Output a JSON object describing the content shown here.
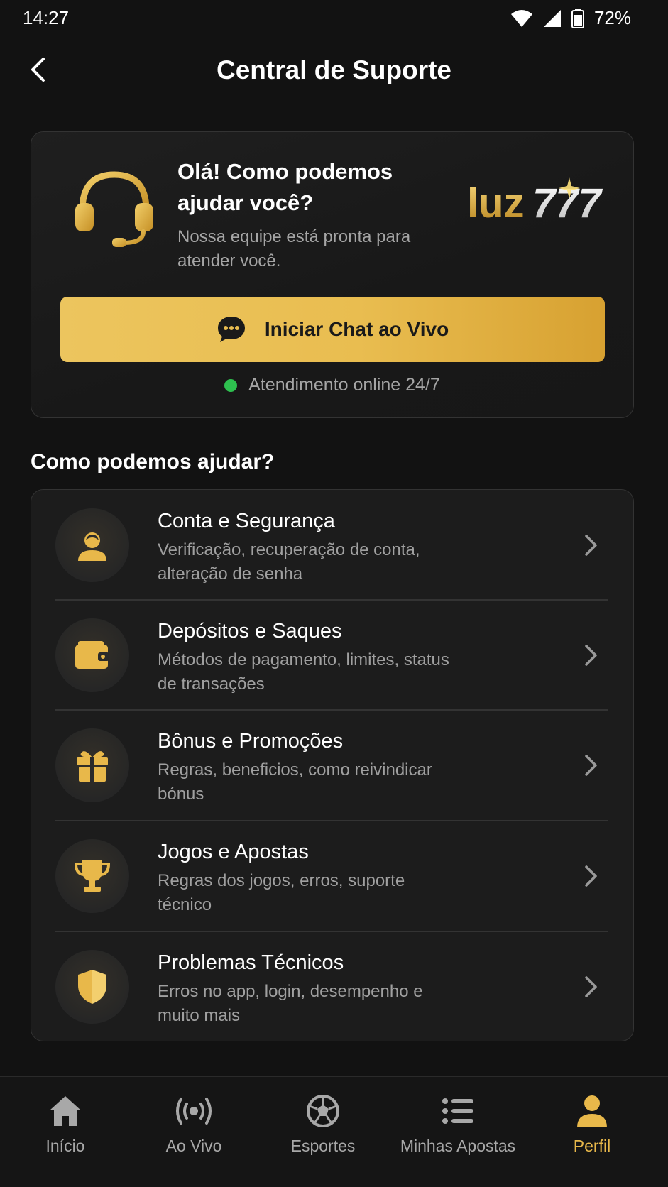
{
  "status_bar": {
    "time": "14:27",
    "battery": "72%",
    "icons": [
      "wifi-icon",
      "signal-icon",
      "battery-icon"
    ]
  },
  "header": {
    "title": "Central de Suporte",
    "back_icon": "chevron-left-icon"
  },
  "hero": {
    "title": "Olá! Como podemos ajudar você?",
    "subtitle": "Nossa equipe está pronta para atender você.",
    "brand": "luz777",
    "chat_button": {
      "label": "Iniciar Chat ao Vivo",
      "icon": "chat-bubble-icon"
    },
    "online_status": "Atendimento online 24/7"
  },
  "section": {
    "title": "Como podemos ajudar?"
  },
  "help_items": [
    {
      "title": "Conta e Segurança",
      "desc": "Verificação, recuperação de conta, alteração de senha",
      "icon": "user-icon"
    },
    {
      "title": "Depósitos e Saques",
      "desc": "Métodos de pagamento, limites, status de transações",
      "icon": "wallet-icon"
    },
    {
      "title": "Bônus e Promoções",
      "desc": "Regras, beneficios, como reivindicar bónus",
      "icon": "gift-icon"
    },
    {
      "title": "Jogos e Apostas",
      "desc": "Regras dos jogos, erros, suporte técnico",
      "icon": "trophy-icon"
    },
    {
      "title": "Problemas Técnicos",
      "desc": "Erros no app, login, desempenho e muito mais",
      "icon": "shield-icon"
    }
  ],
  "bottom_nav": [
    {
      "label": "Início",
      "icon": "home-icon",
      "active": false
    },
    {
      "label": "Ao Vivo",
      "icon": "broadcast-icon",
      "active": false
    },
    {
      "label": "Esportes",
      "icon": "soccer-ball-icon",
      "active": false
    },
    {
      "label": "Minhas Apostas",
      "icon": "list-icon",
      "active": false
    },
    {
      "label": "Perfil",
      "icon": "profile-icon",
      "active": true
    }
  ],
  "colors": {
    "background": "#121212",
    "card": "#1c1c1c",
    "gold": "#e8b84a",
    "online_green": "#2ec04f",
    "muted_text": "#a5a5a5"
  }
}
